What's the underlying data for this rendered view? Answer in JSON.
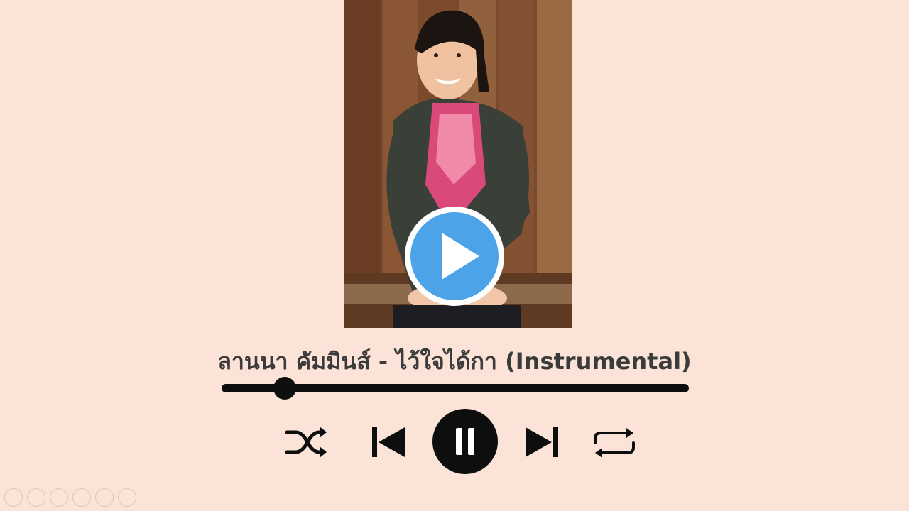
{
  "track": {
    "title": "ลานนา คัมมินส์ - ไว้ใจได้กา (Instrumental)",
    "progress_fraction": 0.135
  },
  "colors": {
    "background": "#fbe3d8",
    "controls": "#0e0e0e",
    "title_text": "#3b3b3b",
    "play_overlay": "#4da3e8"
  },
  "icons": {
    "overlay": "play-icon",
    "shuffle": "shuffle-icon",
    "previous": "skip-previous-icon",
    "pause": "pause-icon",
    "next": "skip-next-icon",
    "repeat": "repeat-icon"
  }
}
